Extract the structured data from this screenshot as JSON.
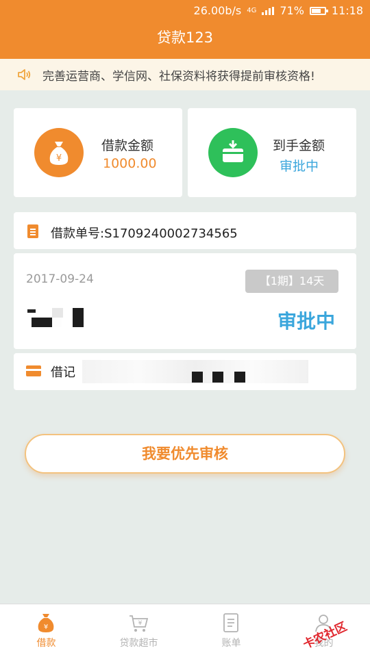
{
  "status_bar": {
    "speed": "26.00b/s",
    "network": "4G",
    "battery_percent": "71%",
    "battery_level": 0.71,
    "time": "11:18"
  },
  "app": {
    "title": "贷款123"
  },
  "notice": {
    "text": "完善运营商、学信网、社保资料将获得提前审核资格!"
  },
  "loan_amount": {
    "label": "借款金额",
    "value": "1000.00"
  },
  "received_amount": {
    "label": "到手金额",
    "value": "审批中"
  },
  "order": {
    "number_label": "借款单号:",
    "number": "S1709240002734565",
    "date": "2017-09-24",
    "period": "【1期】14天",
    "status": "审批中"
  },
  "borrow_card": {
    "label": "借记"
  },
  "priority_button": {
    "label": "我要优先审核"
  },
  "tabs": [
    {
      "label": "借款",
      "icon": "money-bag-icon",
      "active": true
    },
    {
      "label": "贷款超市",
      "icon": "cart-icon",
      "active": false
    },
    {
      "label": "账单",
      "icon": "bill-icon",
      "active": false
    },
    {
      "label": "我的",
      "icon": "user-icon",
      "active": false
    }
  ],
  "watermark": {
    "text": "卡农社区"
  },
  "colors": {
    "primary": "#f08b2e",
    "status_blue": "#3aa6dc",
    "green": "#2ec05a",
    "background": "#e6ece9"
  }
}
